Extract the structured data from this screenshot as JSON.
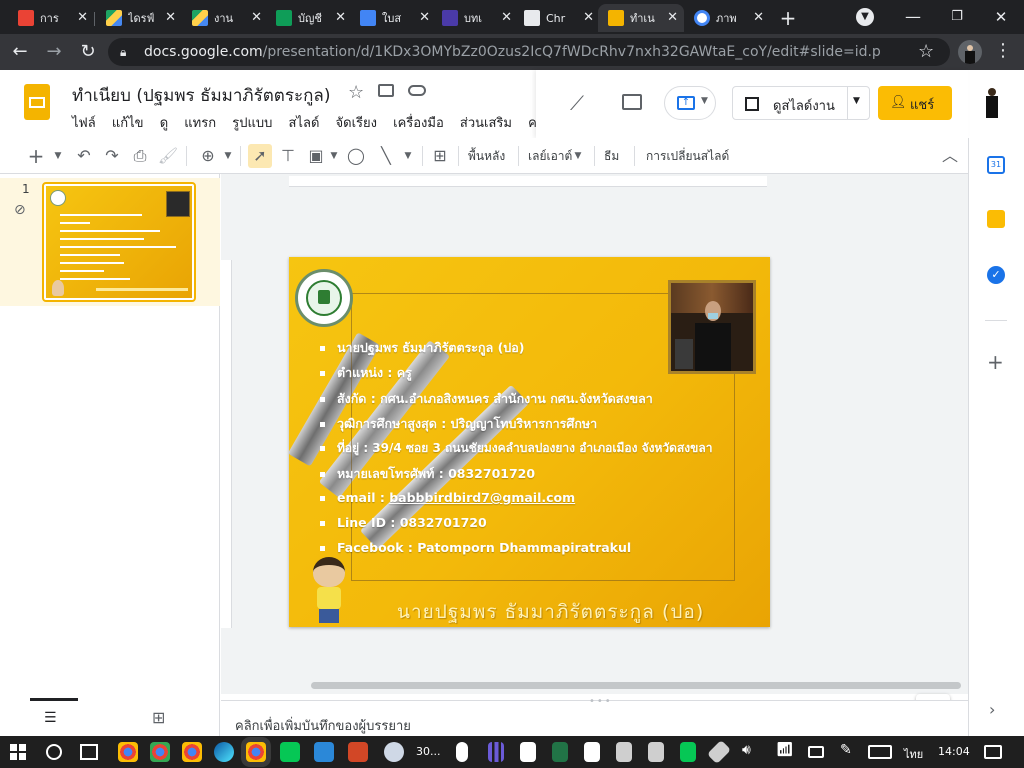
{
  "browser": {
    "tabs": [
      {
        "label": "การ",
        "favicon_color": "#ea4335",
        "active": false
      },
      {
        "label": "ไดรฟ์",
        "favicon_color": "#1fa463",
        "active": false
      },
      {
        "label": "งาน",
        "favicon_color": "#fbbc04",
        "active": false
      },
      {
        "label": "บัญชี",
        "favicon_color": "#0f9d58",
        "active": false
      },
      {
        "label": "ใบส",
        "favicon_color": "#4285f4",
        "active": false
      },
      {
        "label": "บทเ",
        "favicon_color": "#4a3aa8",
        "active": false
      },
      {
        "label": "Chr",
        "favicon_color": "#e8eaed",
        "active": false
      },
      {
        "label": "ทำเน",
        "favicon_color": "#f4b400",
        "active": true
      },
      {
        "label": "ภาพ",
        "favicon_color": "#ffffff",
        "active": false
      }
    ],
    "new_tab": "+",
    "url_host": "docs.google.com",
    "url_path": "/presentation/d/1KDx3OMYbZz0Ozus2IcQ7fWDcRhv7nxh32GAWtaE_coY/edit#slide=id.p"
  },
  "doc": {
    "title": "ทำเนียบ (ปฐมพร ธัมมาภิรัตตระกูล)",
    "menu": [
      "ไฟล์",
      "แก้ไข",
      "ดู",
      "แทรก",
      "รูปแบบ",
      "สไลด์",
      "จัดเรียง",
      "เครื่องมือ",
      "ส่วนเสริม",
      "คว"
    ],
    "present_label": "ดูสไลด์งาน",
    "share_label": "แชร์"
  },
  "toolbar": {
    "background_label": "พื้นหลัง",
    "layout_label": "เลย์เอาต์",
    "theme_label": "ธีม",
    "transition_label": "การเปลี่ยนสไลด์"
  },
  "filmstrip": {
    "slide_number": "1"
  },
  "slide": {
    "items": [
      "นายปฐมพร ธัมมาภิรัตตระกูล (ปอ)",
      "ตำแหน่ง : ครู",
      "สังกัด : กศน.อำเภอสิงหนคร สำนักงาน กศน.จังหวัดสงขลา",
      "วุฒิการศึกษาสูงสุด : ปริญญาโทบริหารการศึกษา",
      "ที่อยู่ : 39/4 ซอย 3 ถนนชัยมงคลำบลปองยาง อำเภอเมือง จังหวัดสงขลา",
      "หมายเลขโทรศัพท์ :  0832701720",
      "Line ID : 0832701720",
      "Facebook  : Patomporn Dhammapiratrakul"
    ],
    "email_label": "email : ",
    "email_value": "babbbirdbird7@gmail.com",
    "footer_name": "นายปฐมพร ธัมมาภิรัตตระกูล (ปอ)"
  },
  "notes": {
    "placeholder": "คลิกเพื่อเพิ่มบันทึกของผู้บรรยาย"
  },
  "taskbar": {
    "weather": "30...",
    "language": "ไทย",
    "time": "14:04"
  }
}
